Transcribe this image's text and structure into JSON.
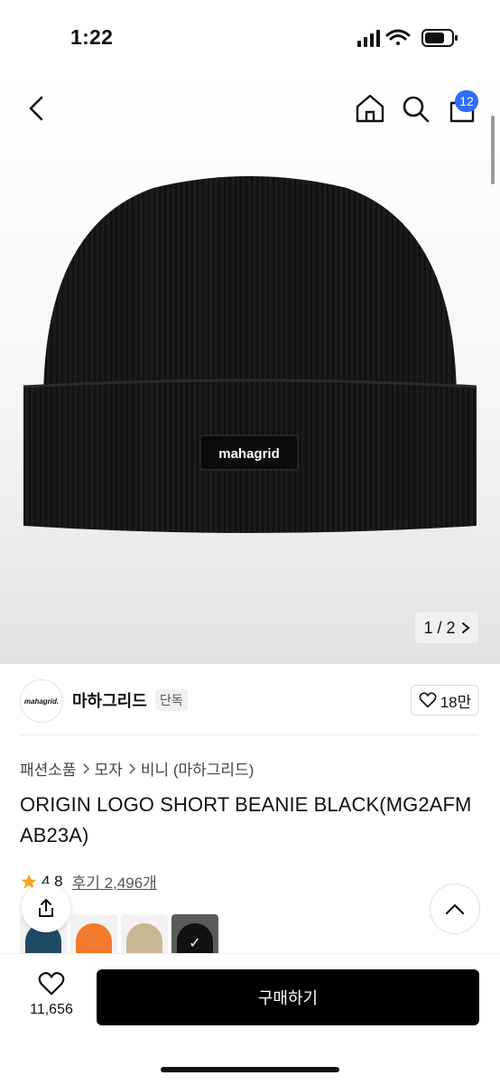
{
  "status_bar": {
    "time": "1:22"
  },
  "header": {
    "cart_count": "12"
  },
  "hero": {
    "image_counter": "1 / 2",
    "hat_label": "mahagrid"
  },
  "brand": {
    "logo_text": "mahagrid.",
    "name": "마하그리드",
    "tag": "단독",
    "likes": "18만"
  },
  "breadcrumb": [
    "패션소품",
    "모자",
    "비니 (마하그리드)"
  ],
  "product": {
    "title": "ORIGIN LOGO SHORT BEANIE BLACK(MG2AFMAB23A)"
  },
  "rating": {
    "score": "4.8",
    "reviews": "후기 2,496개"
  },
  "swatches": [
    {
      "color": "#1f4a66"
    },
    {
      "color": "#f27a2c"
    },
    {
      "color": "#c8b793"
    },
    {
      "color": "#111111",
      "selected": true
    }
  ],
  "bottom": {
    "wish_count": "11,656",
    "buy_label": "구매하기"
  },
  "colors": {
    "accent_badge": "#2f6bff",
    "buy_button": "#000000"
  }
}
